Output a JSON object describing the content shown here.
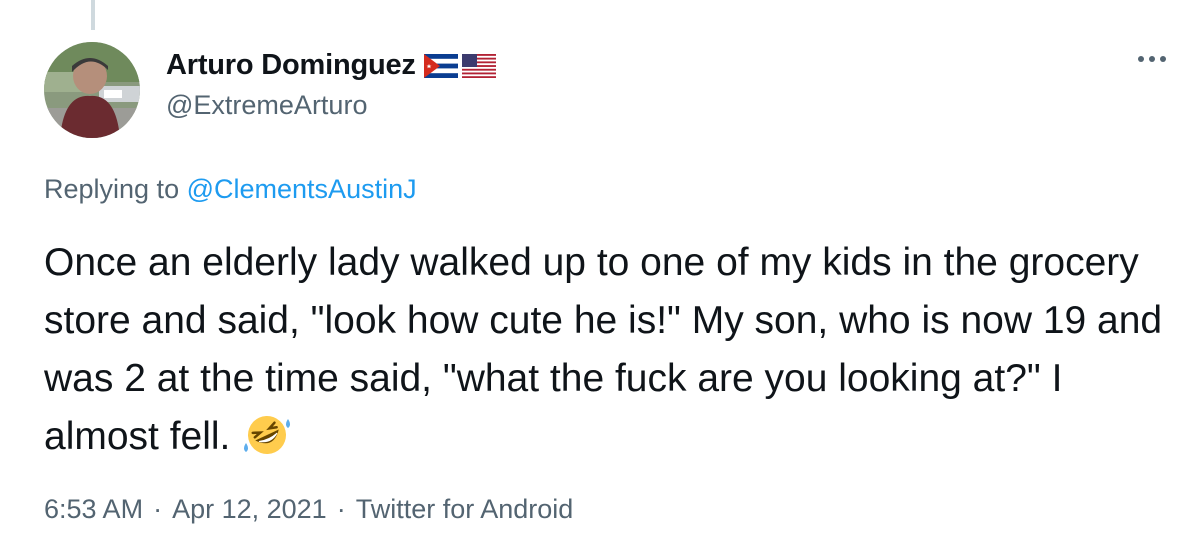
{
  "tweet": {
    "author": {
      "display_name": "Arturo Dominguez",
      "handle": "@ExtremeArturo",
      "flags": [
        "cuba-flag-icon",
        "us-flag-icon"
      ]
    },
    "more_icon": "more-horizontal-icon",
    "reply_prefix": "Replying to",
    "reply_to": "@ClementsAustinJ",
    "text": "Once an elderly lady walked up to one of my kids in the grocery store and said, \"look how cute he is!\" My son, who is now 19 and was 2 at the time said, \"what the fuck are you looking at?\" I almost fell.",
    "emoji": "rolling-on-floor-laughing-emoji",
    "time": "6:53 AM",
    "date": "Apr 12, 2021",
    "source": "Twitter for Android",
    "separator": "·"
  },
  "colors": {
    "text": "#0f1419",
    "secondary": "#536471",
    "link": "#1d9bf0",
    "thread_line": "#cfd9de"
  }
}
